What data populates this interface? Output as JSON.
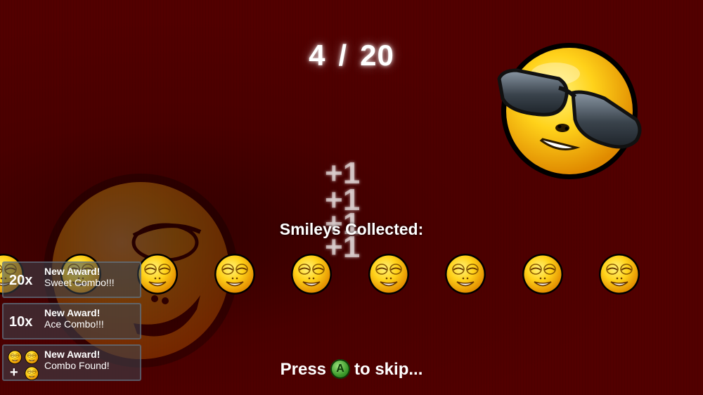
{
  "hud": {
    "collected_count": "4",
    "separator": "/",
    "total_count": "20"
  },
  "collected_label": "Smileys Collected:",
  "score_popups": [
    "+1",
    "+1",
    "+1",
    "+1"
  ],
  "collected_smileys": {
    "icon": "blissful-smiley-icon",
    "count": 9
  },
  "awards": [
    {
      "header": "New Award!",
      "multiplier": "20x",
      "name": "Sweet Combo!!!"
    },
    {
      "header": "New Award!",
      "multiplier": "10x",
      "name": "Ace Combo!!!"
    },
    {
      "header": "New Award!",
      "multiplier": "",
      "combo_symbol": "+",
      "name": "Combo Found!"
    }
  ],
  "skip_prompt": {
    "press": "Press",
    "button": "A",
    "rest": "to skip..."
  },
  "colors": {
    "background": "#4a0000",
    "smiley_yellow": "#ffd21a",
    "button_green": "#3c9a2a",
    "award_panel": "#3c4650"
  }
}
